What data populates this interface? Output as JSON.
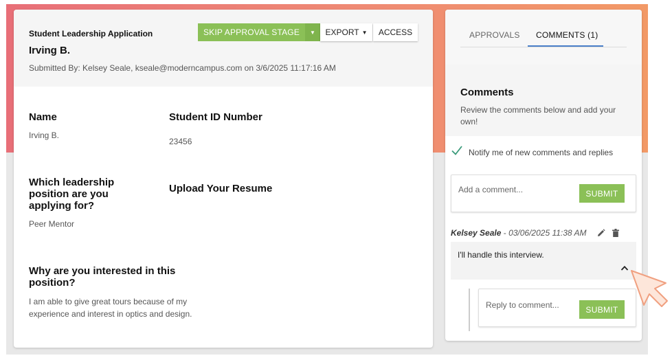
{
  "application": {
    "form_title": "Student Leadership Application",
    "applicant_name": "Irving B.",
    "submitted_by": "Submitted By: Kelsey Seale, kseale@moderncampus.com on 3/6/2025 11:17:16 AM"
  },
  "toolbar": {
    "skip_label": "SKIP APPROVAL STAGE",
    "export_label": "EXPORT",
    "access_label": "ACCESS"
  },
  "fields": {
    "name_label": "Name",
    "name_value": "Irving B.",
    "student_id_label": "Student ID Number",
    "student_id_value": "23456",
    "position_label": "Which leadership position are you applying for?",
    "position_value": "Peer Mentor",
    "resume_label": "Upload Your Resume",
    "interest_label": "Why are you interested in this position?",
    "interest_value": "I am able to give great tours because of my experience and interest in optics and design."
  },
  "tabs": {
    "approvals": "APPROVALS",
    "comments": "COMMENTS (1)",
    "active": "comments"
  },
  "comments_panel": {
    "title": "Comments",
    "description": "Review the comments below and add your own!",
    "notify_label": "Notify me of new comments and replies",
    "notify_checked": true,
    "add_placeholder": "Add a comment...",
    "submit_label": "SUBMIT",
    "reply_placeholder": "Reply to comment...",
    "reply_submit_label": "SUBMIT"
  },
  "comments": [
    {
      "author": "Kelsey Seale",
      "separator": " - ",
      "date": "03/06/2025 11:38 AM",
      "text": "I'll handle this interview."
    }
  ],
  "colors": {
    "accent_green": "#8bc057",
    "tab_underline": "#4a7fc9",
    "banner_start": "#e86f78",
    "banner_end": "#f29966"
  },
  "icons": {
    "export_caret": "caret-down-icon",
    "skip_caret": "caret-down-icon",
    "notify": "check-icon",
    "edit": "pencil-icon",
    "delete": "trash-icon",
    "collapse": "chevron-up-icon",
    "pointer": "cursor-arrow-icon"
  }
}
